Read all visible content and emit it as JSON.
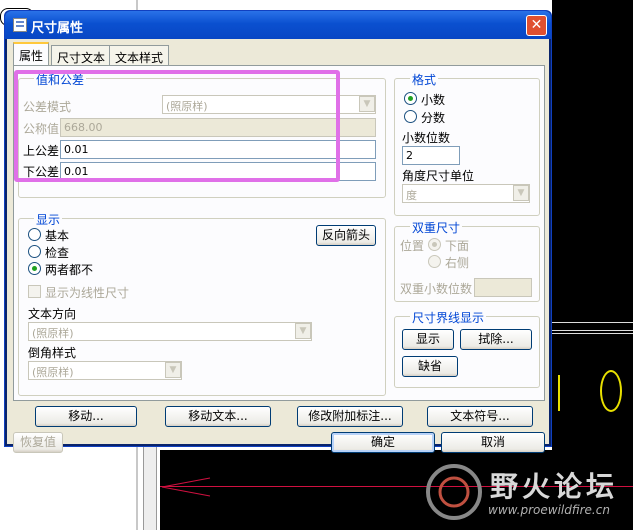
{
  "dialog": {
    "title": "尺寸属性",
    "close_symbol": "✕"
  },
  "tabs": [
    {
      "label": "属性",
      "active": true
    },
    {
      "label": "尺寸文本",
      "active": false
    },
    {
      "label": "文本样式",
      "active": false
    }
  ],
  "tolerance": {
    "title": "值和公差",
    "mode_label": "公差模式",
    "mode_value": "(照原样)",
    "nominal_label": "公称值",
    "nominal_value": "668.00",
    "upper_label": "上公差",
    "upper_value": "0.01",
    "lower_label": "下公差",
    "lower_value": "0.01"
  },
  "format": {
    "title": "格式",
    "decimal_label": "小数",
    "fraction_label": "分数",
    "decimal_selected": true,
    "decimal_places_label": "小数位数",
    "decimal_places_value": "2",
    "angle_unit_label": "角度尺寸单位",
    "angle_unit_value": "度"
  },
  "display": {
    "title": "显示",
    "basic_label": "基本",
    "inspect_label": "检查",
    "neither_label": "两者都不",
    "selected": "neither",
    "flip_arrows_label": "反向箭头",
    "linear_label": "显示为线性尺寸",
    "text_direction_label": "文本方向",
    "text_direction_value": "(照原样)",
    "chamfer_label": "倒角样式",
    "chamfer_value": "(照原样)"
  },
  "dual": {
    "title": "双重尺寸",
    "position_label": "位置",
    "below_label": "下面",
    "right_label": "右侧",
    "dual_decimals_label": "双重小数位数"
  },
  "witness": {
    "title": "尺寸界线显示",
    "show_label": "显示",
    "erase_label": "拭除...",
    "default_label": "缺省"
  },
  "actions": {
    "move_label": "移动...",
    "move_text_label": "移动文本...",
    "modify_attach_label": "修改附加标注...",
    "text_symbol_label": "文本符号...",
    "restore_label": "恢复值",
    "ok_label": "确定",
    "cancel_label": "取消"
  },
  "watermark": {
    "title": "野火论坛",
    "url": "www.proewildfire.cn"
  },
  "colors": {
    "titlebar": "#0a50d0",
    "group_title": "#0046d5",
    "highlight": "#e070e8"
  }
}
